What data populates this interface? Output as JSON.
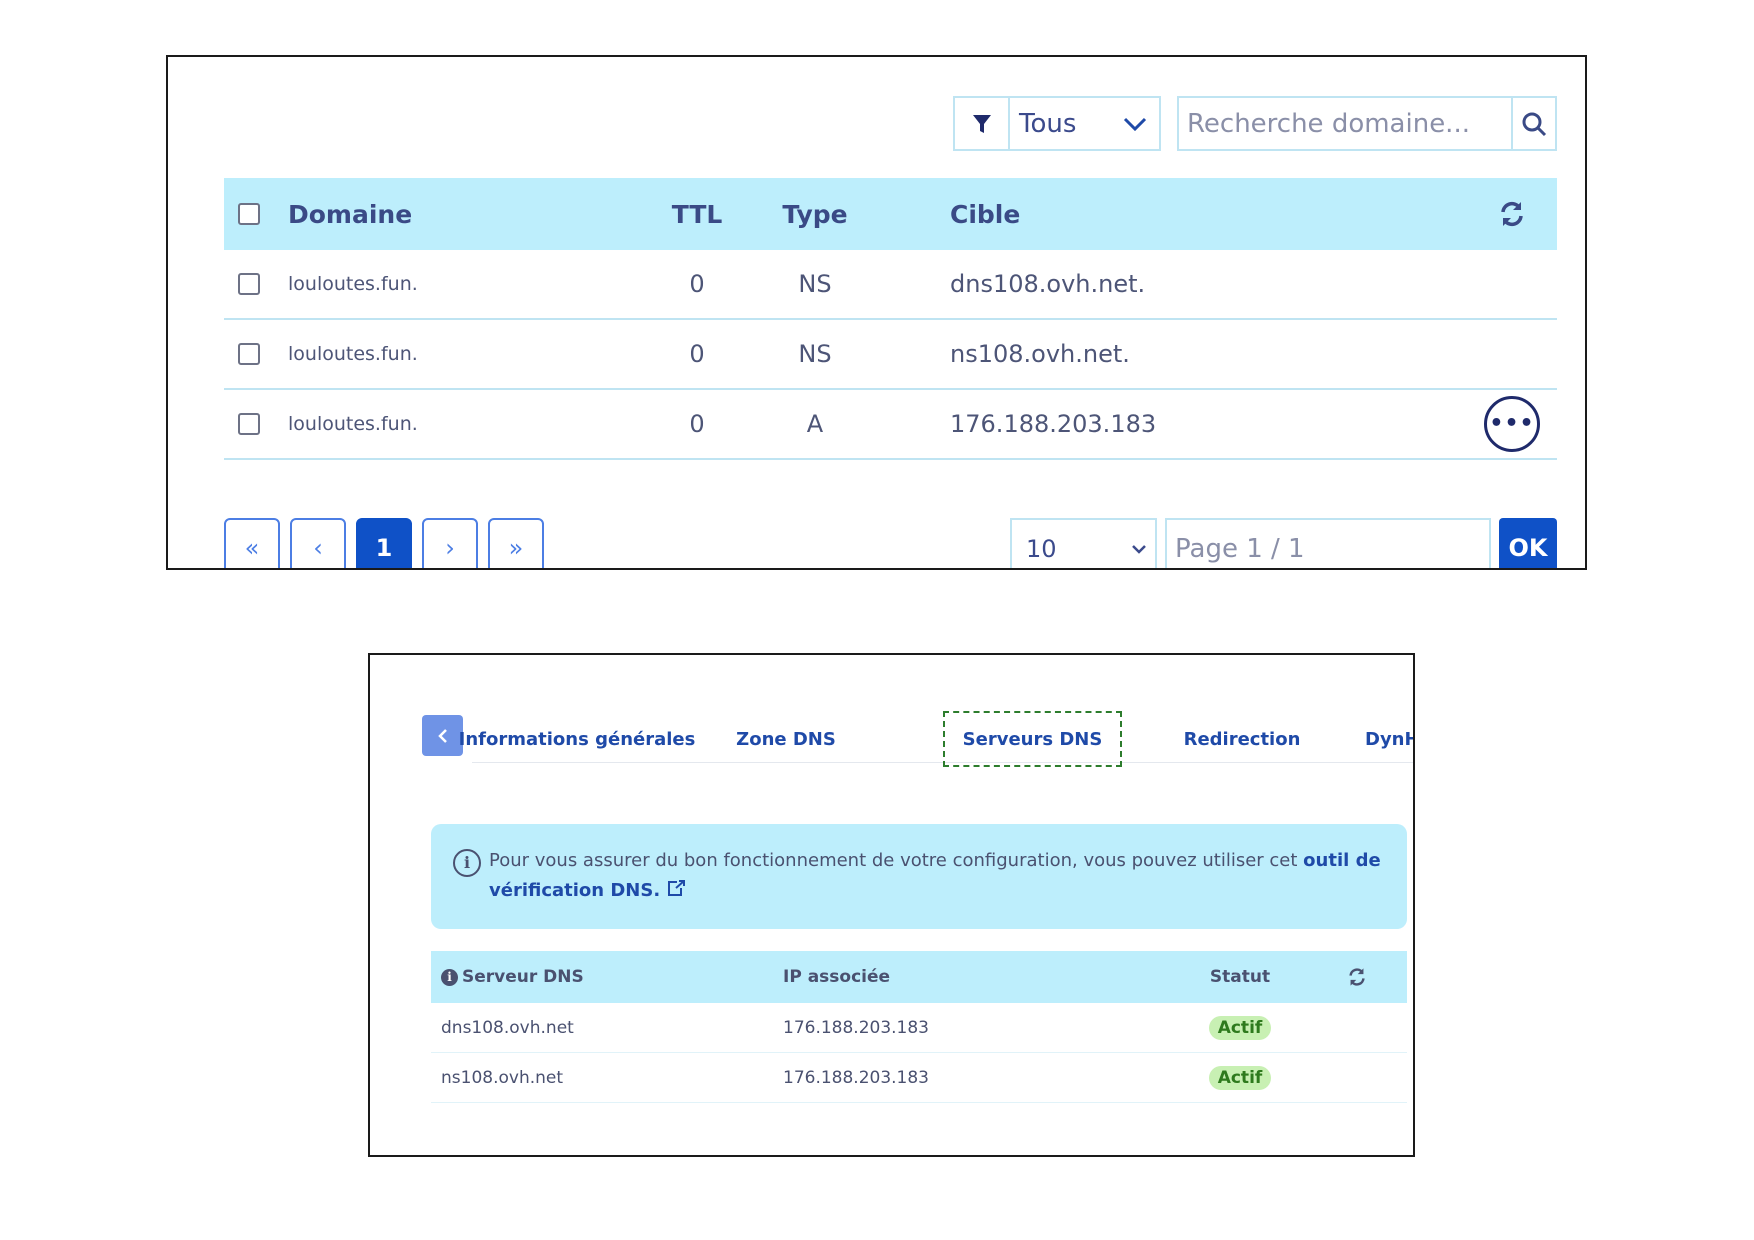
{
  "zone": {
    "filter": {
      "selected": "Tous"
    },
    "search": {
      "placeholder": "Recherche domaine..."
    },
    "columns": {
      "domain": "Domaine",
      "ttl": "TTL",
      "type": "Type",
      "target": "Cible"
    },
    "rows": [
      {
        "domain": "louloutes.fun.",
        "ttl": "0",
        "type": "NS",
        "target": "dns108.ovh.net."
      },
      {
        "domain": "louloutes.fun.",
        "ttl": "0",
        "type": "NS",
        "target": "ns108.ovh.net."
      },
      {
        "domain": "louloutes.fun.",
        "ttl": "0",
        "type": "A",
        "target": "176.188.203.183"
      }
    ],
    "pagination": {
      "first": "«",
      "prev": "‹",
      "current": "1",
      "next": "›",
      "last": "»",
      "page_size": "10",
      "page_placeholder": "Page 1 / 1",
      "ok": "OK"
    }
  },
  "servers_panel": {
    "tabs": [
      {
        "label": "Informations générales"
      },
      {
        "label": "Zone DNS"
      },
      {
        "label": "Serveurs DNS"
      },
      {
        "label": "Redirection"
      },
      {
        "label": "DynHost"
      }
    ],
    "active_tab": "Serveurs DNS",
    "info": {
      "text": "Pour vous assurer du bon fonctionnement de votre configuration, vous pouvez utiliser cet ",
      "link": "outil de vérification DNS."
    },
    "columns": {
      "server": "Serveur DNS",
      "ip": "IP associée",
      "status": "Statut"
    },
    "rows": [
      {
        "server": "dns108.ovh.net",
        "ip": "176.188.203.183",
        "status": "Actif"
      },
      {
        "server": "ns108.ovh.net",
        "ip": "176.188.203.183",
        "status": "Actif"
      }
    ]
  },
  "colors": {
    "table_header": "#bdeefc",
    "primary": "#0f51c7",
    "link": "#1f4aa8",
    "badge_bg": "#c8f0b3",
    "badge_text": "#2e7a1d"
  }
}
